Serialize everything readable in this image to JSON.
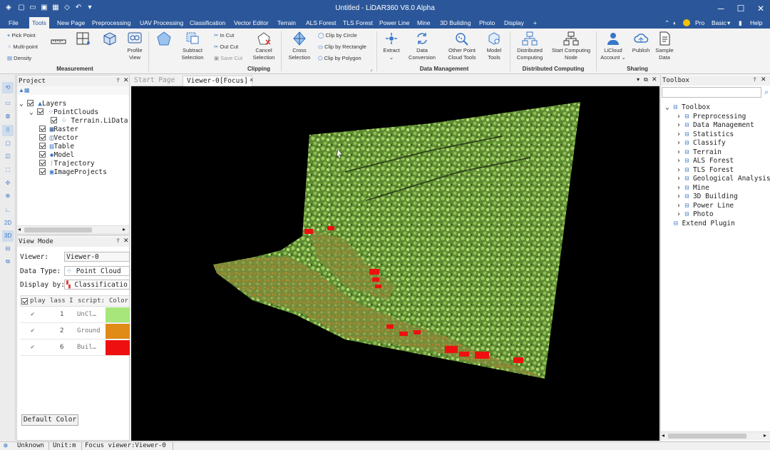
{
  "app": {
    "title": "Untitled - LiDAR360 V8.0 Alpha"
  },
  "menubar": {
    "items": [
      "File",
      "Tools",
      "New Page",
      "Preprocessing",
      "UAV Processing",
      "Classification",
      "Vector Editor",
      "Terrain",
      "ALS Forest",
      "TLS Forest",
      "Power Line",
      "Mine",
      "3D Building",
      "Photo",
      "Display",
      "+"
    ],
    "right": {
      "pro": "Pro",
      "basic": "Basic",
      "help": "Help"
    }
  },
  "ribbon": {
    "measurement": {
      "pick_point": "Pick Point",
      "multi_point": "Multi-point",
      "density": "Density",
      "profile_view": [
        "Profile",
        "View"
      ],
      "group": "Measurement"
    },
    "clipping": {
      "subtract": [
        "Subtract",
        "Selection"
      ],
      "in_cut": "In Cut",
      "out_cut": "Out Cut",
      "save_cut": "Save Cut",
      "cancel": [
        "Cancel",
        "Selection"
      ],
      "cross": [
        "Cross",
        "Selection"
      ],
      "clip_circle": "Clip by Circle",
      "clip_rect": "Clip by Rectangle",
      "clip_poly": "Clip by Polygon",
      "group": "Clipping"
    },
    "data_management": {
      "extract": "Extract",
      "data_conversion": [
        "Data",
        "Conversion"
      ],
      "other_tools": [
        "Other Point",
        "Cloud Tools"
      ],
      "model_tools": [
        "Model",
        "Tools"
      ],
      "group": "Data Management"
    },
    "distributed": {
      "dist": [
        "Distributed",
        "Computing"
      ],
      "start": [
        "Start Computing",
        "Node"
      ],
      "group": "Distributed Computing"
    },
    "sharing": {
      "licloud": [
        "LiCloud",
        "Account"
      ],
      "publish": "Publish",
      "sample": [
        "Sample",
        "Data"
      ],
      "group": "Sharing"
    }
  },
  "project": {
    "title": "Project",
    "layers": "Layers",
    "pointclouds": "PointClouds",
    "terrain": "Terrain.LiData",
    "raster": "Raster",
    "vector": "Vector",
    "table": "Table",
    "model": "Model",
    "trajectory": "Trajectory",
    "imageprojects": "ImageProjects"
  },
  "viewmode": {
    "title": "View Mode",
    "viewer_label": "Viewer:",
    "viewer_value": "Viewer-0",
    "datatype_label": "Data Type:",
    "datatype_value": "Point Cloud",
    "displayby_label": "Display by:",
    "displayby_value": "Classificatio",
    "headers": [
      "play",
      "lass I",
      "script:",
      "Color"
    ],
    "rows": [
      {
        "id": "1",
        "desc": "UnCl…",
        "color": "#a6e67a"
      },
      {
        "id": "2",
        "desc": "Ground",
        "color": "#e08a18"
      },
      {
        "id": "6",
        "desc": "Buil…",
        "color": "#ee1010"
      }
    ],
    "default_color": "Default Color"
  },
  "viewer": {
    "tab_start": "Start Page",
    "tab_viewer": "Viewer-0[Focus]",
    "close": "×"
  },
  "toolbox": {
    "title": "Toolbox",
    "root": "Toolbox",
    "items": [
      "Preprocessing",
      "Data Management",
      "Statistics",
      "Classify",
      "Terrain",
      "ALS Forest",
      "TLS Forest",
      "Geological Analysis",
      "Mine",
      "3D Building",
      "Power Line",
      "Photo"
    ],
    "extend": "Extend Plugin"
  },
  "status": {
    "crs": "Unknown",
    "unit": "Unit:m",
    "focus": "Focus viewer:Viewer-0"
  },
  "colors": {
    "accent": "#2b579a",
    "unclassified": "#a6e67a",
    "ground": "#e08a18",
    "building": "#ee1010"
  }
}
